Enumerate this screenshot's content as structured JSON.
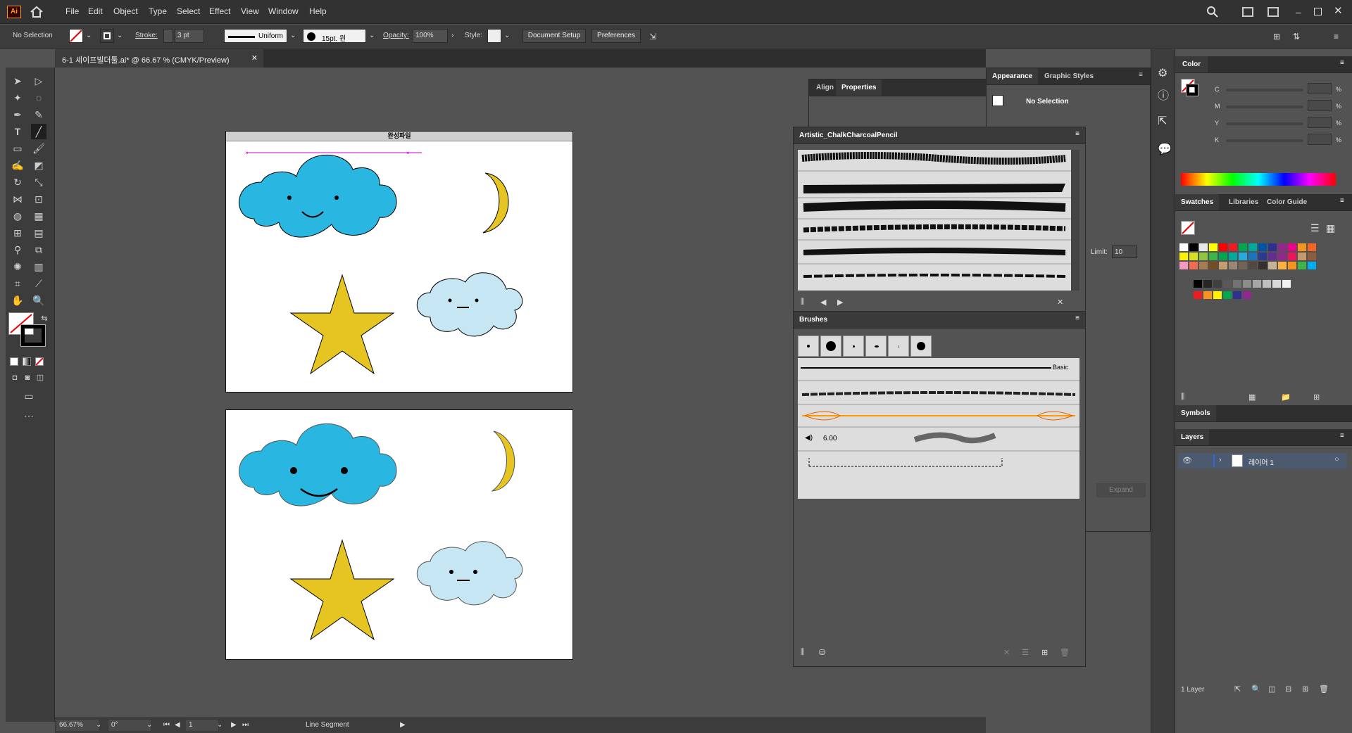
{
  "app": {
    "logo": "Ai"
  },
  "menu": [
    "File",
    "Edit",
    "Object",
    "Type",
    "Select",
    "Effect",
    "View",
    "Window",
    "Help"
  ],
  "control": {
    "selection": "No Selection",
    "stroke_label": "Stroke:",
    "stroke_weight": "3 pt",
    "profile": "Uniform",
    "brush": "15pt. 원",
    "opacity_label": "Opacity:",
    "opacity": "100%",
    "style_label": "Style:",
    "document_setup": "Document Setup",
    "preferences": "Preferences"
  },
  "document": {
    "tab_title": "6-1 셰이프빌더툴.ai* @ 66.67 % (CMYK/Preview)"
  },
  "artboard1": {
    "title": "완성파일"
  },
  "status": {
    "zoom": "66.67%",
    "rotation": "0°",
    "page": "1",
    "tool": "Line Segment"
  },
  "properties_panel": {
    "tabs": [
      "Align",
      "Properties"
    ]
  },
  "appearance_panel": {
    "tabs": [
      "Appearance",
      "Graphic Styles"
    ],
    "selection": "No Selection",
    "limit_label": "Limit:",
    "limit": "10",
    "expand": "Expand"
  },
  "brush_library": {
    "title": "Artistic_ChalkCharcoalPencil"
  },
  "brushes_panel": {
    "title": "Brushes",
    "basic_label": "Basic",
    "size_value": "6.00"
  },
  "color_panel": {
    "title": "Color",
    "channels": [
      "C",
      "M",
      "Y",
      "K"
    ],
    "unit": "%"
  },
  "swatches_panel": {
    "tabs": [
      "Swatches",
      "Libraries",
      "Color Guide"
    ]
  },
  "symbols_panel": {
    "title": "Symbols"
  },
  "layers_panel": {
    "title": "Layers",
    "layer_name": "레이어 1",
    "count": "1 Layer"
  },
  "colors": {
    "cloud": "#29b6e0",
    "light_cloud": "#c5e6f2",
    "star": "#e6c522",
    "accent": "#ff9a00"
  },
  "swatch_colors": [
    [
      "#ffffff",
      "#000000",
      "#e8e8e8",
      "#ffff00",
      "#ff0000",
      "#ed1c24",
      "#00a651",
      "#00a99d",
      "#0054a6",
      "#2e3192",
      "#92278f",
      "#ec008c",
      "#f7941d",
      "#f26522"
    ],
    [
      "#fff200",
      "#d7df23",
      "#8dc63f",
      "#39b54a",
      "#00a651",
      "#00a99d",
      "#27aae1",
      "#1c75bc",
      "#2b3990",
      "#662d91",
      "#92278f",
      "#ed145b",
      "#c49a6c",
      "#8b5e3c"
    ],
    [
      "#f49ac1",
      "#f26c4f",
      "#a67c52",
      "#754c24",
      "#c69c6d",
      "#998675",
      "#736357",
      "#534741",
      "#362f2d",
      "#c7b299",
      "#fbb040",
      "#f7941d",
      "#39b54a",
      "#00aeef"
    ]
  ],
  "gray_swatches": [
    "#000000",
    "#262626",
    "#404040",
    "#595959",
    "#737373",
    "#8c8c8c",
    "#a6a6a6",
    "#bfbfbf",
    "#d9d9d9",
    "#f2f2f2"
  ],
  "group_swatches": [
    "#ed1c24",
    "#f7941d",
    "#fff200",
    "#00a651",
    "#2e3192",
    "#92278f"
  ]
}
